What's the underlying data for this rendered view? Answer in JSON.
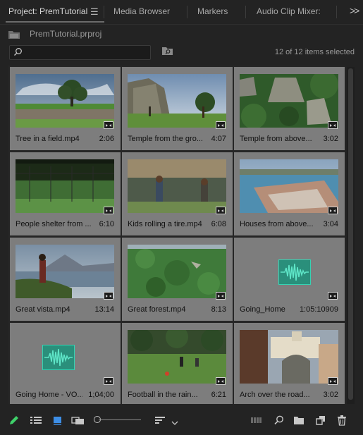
{
  "tabs": [
    {
      "label": "Project: PremTutorial",
      "active": true
    },
    {
      "label": "Media Browser",
      "active": false
    },
    {
      "label": "Markers",
      "active": false
    },
    {
      "label": "Audio Clip Mixer:",
      "active": false
    }
  ],
  "project": {
    "file_name": "PremTutorial.prproj"
  },
  "search": {
    "placeholder": ""
  },
  "item_count": "12 of 12 items selected",
  "clips": [
    {
      "name": "Tree in a field.mp4",
      "duration": "2:06",
      "type": "video"
    },
    {
      "name": "Temple from the gro...",
      "duration": "4:07",
      "type": "video"
    },
    {
      "name": "Temple from above...",
      "duration": "3:02",
      "type": "video"
    },
    {
      "name": "People shelter from ...",
      "duration": "6:10",
      "type": "video"
    },
    {
      "name": "Kids rolling a tire.mp4",
      "duration": "6:08",
      "type": "video"
    },
    {
      "name": "Houses from above...",
      "duration": "3:04",
      "type": "video"
    },
    {
      "name": "Great vista.mp4",
      "duration": "13:14",
      "type": "video"
    },
    {
      "name": "Great forest.mp4",
      "duration": "8:13",
      "type": "video"
    },
    {
      "name": "Going_Home...",
      "duration": "1:05:10909",
      "type": "audio"
    },
    {
      "name": "Going Home - VO...",
      "duration": "1;04;00",
      "type": "audio"
    },
    {
      "name": "Football in the rain...",
      "duration": "6:21",
      "type": "video"
    },
    {
      "name": "Arch over the road...",
      "duration": "3:02",
      "type": "video"
    }
  ],
  "colors": {
    "accent_green": "#3fd16a",
    "accent_blue": "#3d8ee6",
    "audio_wave": "#35d3b3"
  }
}
